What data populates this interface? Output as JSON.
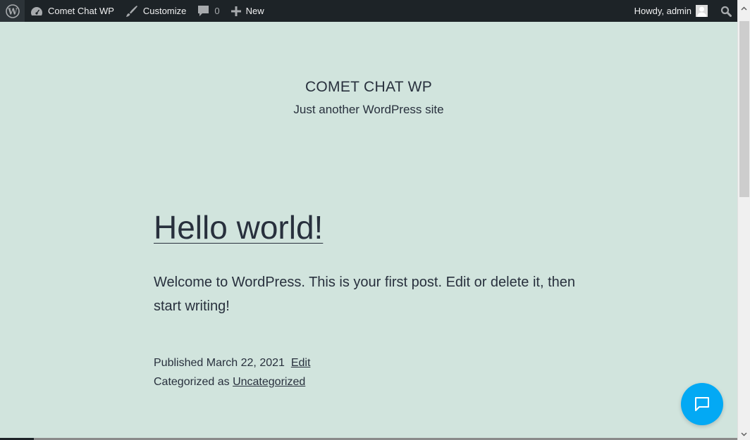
{
  "adminbar": {
    "site_name": "Comet Chat WP",
    "customize_label": "Customize",
    "comments_count": "0",
    "new_label": "New",
    "greeting": "Howdy, admin"
  },
  "site": {
    "title": "COMET CHAT WP",
    "description": "Just another WordPress site"
  },
  "post": {
    "title": "Hello world!",
    "body": "Welcome to WordPress. This is your first post. Edit or delete it, then start writing!",
    "published_label": "Published",
    "date": "March 22, 2021",
    "edit_label": "Edit",
    "categorized_label": "Categorized as",
    "category": "Uncategorized"
  },
  "chat": {
    "icon": "chat-bubble-icon",
    "color": "#03a9f4"
  }
}
